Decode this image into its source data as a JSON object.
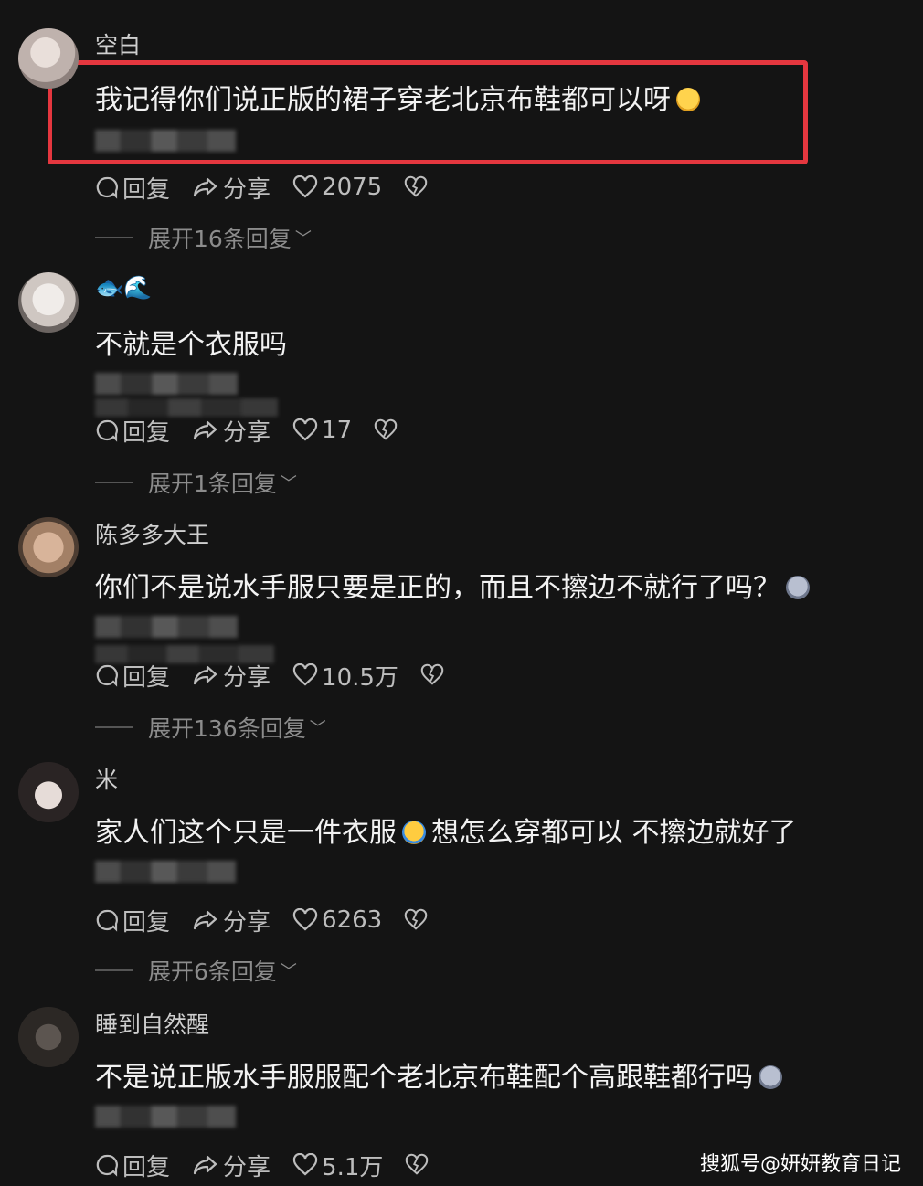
{
  "comments": [
    {
      "username": "空白",
      "text": "我记得你们说正版的裙子穿老北京布鞋都可以呀",
      "emoji": "laughing-sweat-emoji",
      "reply_label": "回复",
      "share_label": "分享",
      "likes": "2075",
      "expand_label": "展开16条回复"
    },
    {
      "username": "🐟🌊",
      "text": "不就是个衣服吗",
      "reply_label": "回复",
      "share_label": "分享",
      "likes": "17",
      "expand_label": "展开1条回复"
    },
    {
      "username": "陈多多大王",
      "text": "你们不是说水手服只要是正的，而且不擦边不就行了吗？",
      "emoji": "shocked-face-emoji",
      "reply_label": "回复",
      "share_label": "分享",
      "likes": "10.5万",
      "expand_label": "展开136条回复"
    },
    {
      "username": "米",
      "text_before": "家人们这个只是一件衣服",
      "text_after": "想怎么穿都可以 不擦边就好了",
      "emoji": "crying-laugh-emoji",
      "reply_label": "回复",
      "share_label": "分享",
      "likes": "6263",
      "expand_label": "展开6条回复"
    },
    {
      "username": "睡到自然醒",
      "text": "不是说正版水手服服配个老北京布鞋配个高跟鞋都行吗",
      "emoji": "shocked-face-emoji",
      "reply_label": "回复",
      "share_label": "分享",
      "likes": "5.1万"
    }
  ],
  "watermark": "搜狐号@妍妍教育日记",
  "colors": {
    "background": "#141414",
    "highlight": "#e5373f"
  }
}
